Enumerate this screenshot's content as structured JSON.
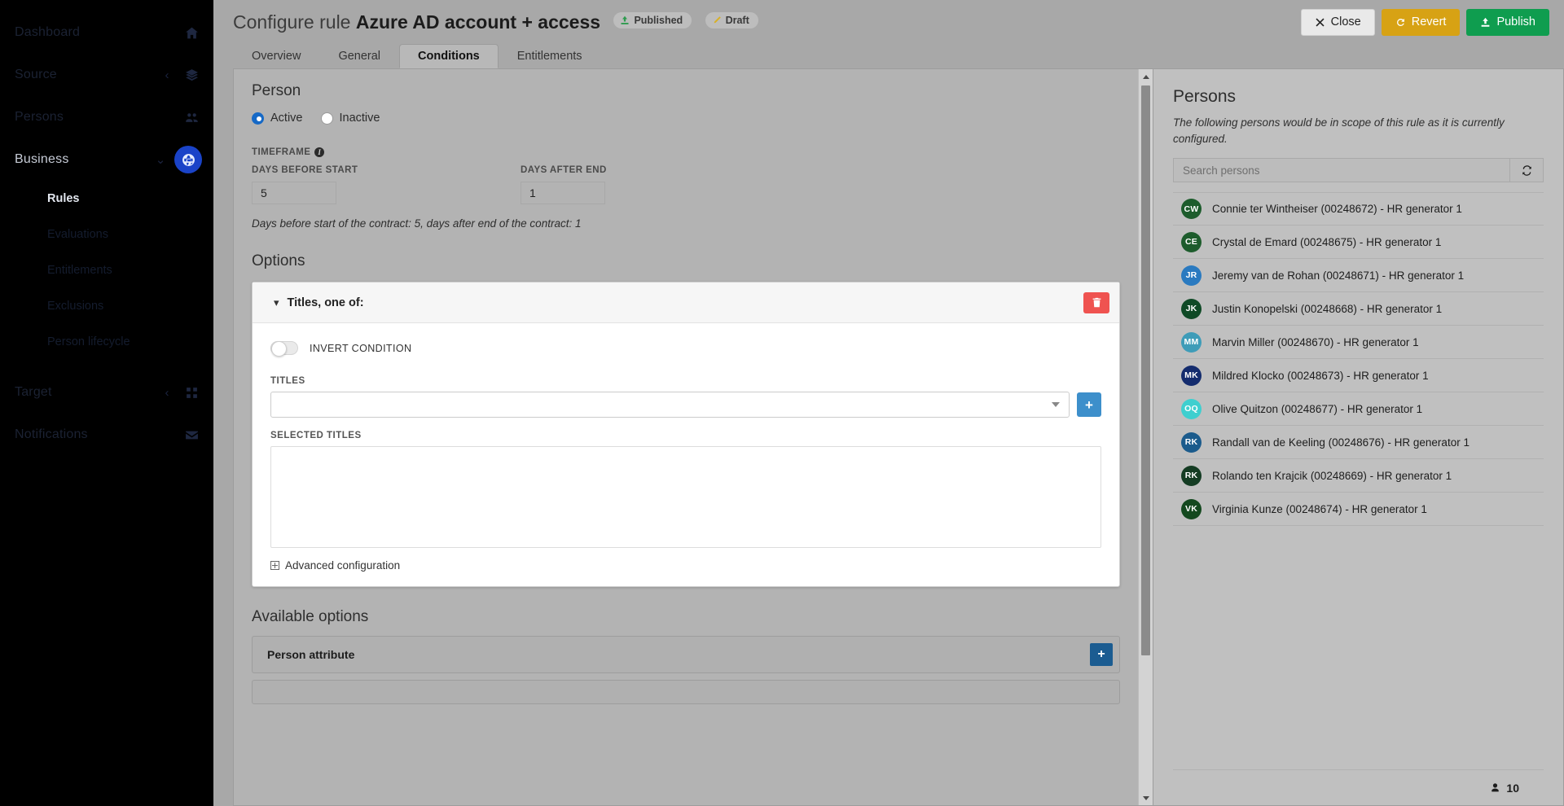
{
  "sidebar": {
    "items": [
      {
        "label": "Dashboard",
        "icon": "home-icon",
        "chevron": "",
        "active": false
      },
      {
        "label": "Source",
        "icon": "layers-icon",
        "chevron": "‹",
        "active": false
      },
      {
        "label": "Persons",
        "icon": "people-icon",
        "chevron": "",
        "active": false
      },
      {
        "label": "Business",
        "icon": "globe-icon",
        "chevron": "⌄",
        "active": true
      }
    ],
    "sub_items": [
      {
        "label": "Rules",
        "active": true
      },
      {
        "label": "Evaluations",
        "active": false
      },
      {
        "label": "Entitlements",
        "active": false
      },
      {
        "label": "Exclusions",
        "active": false
      },
      {
        "label": "Person lifecycle",
        "active": false
      }
    ],
    "bottom_items": [
      {
        "label": "Target",
        "icon": "grid-icon",
        "chevron": "‹"
      },
      {
        "label": "Notifications",
        "icon": "mail-icon",
        "chevron": ""
      }
    ]
  },
  "header": {
    "title_prefix": "Configure rule",
    "rule_name": "Azure AD account + access",
    "badges": [
      {
        "label": "Published",
        "icon": "upload-icon",
        "color": "#2e9b4f"
      },
      {
        "label": "Draft",
        "icon": "pencil-icon",
        "color": "#d8b026"
      }
    ],
    "buttons": {
      "close": "Close",
      "revert": "Revert",
      "publish": "Publish"
    }
  },
  "tabs": [
    {
      "label": "Overview",
      "selected": false
    },
    {
      "label": "General",
      "selected": false
    },
    {
      "label": "Conditions",
      "selected": true
    },
    {
      "label": "Entitlements",
      "selected": false
    }
  ],
  "person_section": {
    "title": "Person",
    "radios": [
      {
        "label": "Active",
        "checked": true
      },
      {
        "label": "Inactive",
        "checked": false
      }
    ],
    "timeframe_label": "TIMEFRAME",
    "days_before_start_label": "DAYS BEFORE START",
    "days_before_start_value": "5",
    "days_after_end_label": "DAYS AFTER END",
    "days_after_end_value": "1",
    "hint": "Days before start of the contract: 5, days after end of the contract: 1"
  },
  "options": {
    "title": "Options",
    "card": {
      "header": "Titles, one of:",
      "delete_icon": "trash-icon",
      "invert_label": "INVERT CONDITION",
      "invert_on": false,
      "titles_label": "TITLES",
      "titles_value": "",
      "add_icon": "plus-icon",
      "selected_titles_label": "SELECTED TITLES",
      "selected_titles": [],
      "advanced_label": "Advanced configuration"
    }
  },
  "available_options": {
    "title": "Available options",
    "items": [
      {
        "name": "Person attribute",
        "add_icon": "plus-icon"
      }
    ]
  },
  "persons_panel": {
    "title": "Persons",
    "description": "The following persons would be in scope of this rule as it is currently configured.",
    "search_placeholder": "Search persons",
    "search_value": "",
    "refresh_icon": "refresh-icon",
    "people": [
      {
        "initials": "CW",
        "name": "Connie ter Wintheiser (00248672) - HR generator 1",
        "color": "#1d5c2c"
      },
      {
        "initials": "CE",
        "name": "Crystal de Emard (00248675) - HR generator 1",
        "color": "#1d5c2c"
      },
      {
        "initials": "JR",
        "name": "Jeremy van de Rohan (00248671) - HR generator 1",
        "color": "#2a7ac0"
      },
      {
        "initials": "JK",
        "name": "Justin Konopelski (00248668) - HR generator 1",
        "color": "#0f4a26"
      },
      {
        "initials": "MM",
        "name": "Marvin Miller (00248670) - HR generator 1",
        "color": "#3e9cb8"
      },
      {
        "initials": "MK",
        "name": "Mildred Klocko (00248673) - HR generator 1",
        "color": "#142c6e"
      },
      {
        "initials": "OQ",
        "name": "Olive Quitzon (00248677) - HR generator 1",
        "color": "#3ecfcf"
      },
      {
        "initials": "RK",
        "name": "Randall van de Keeling (00248676) - HR generator 1",
        "color": "#1b5b8c"
      },
      {
        "initials": "RK",
        "name": "Rolando ten Krajcik (00248669) - HR generator 1",
        "color": "#143c23"
      },
      {
        "initials": "VK",
        "name": "Virginia Kunze (00248674) - HR generator 1",
        "color": "#14491f"
      }
    ],
    "count": "10",
    "count_icon": "person-icon"
  }
}
